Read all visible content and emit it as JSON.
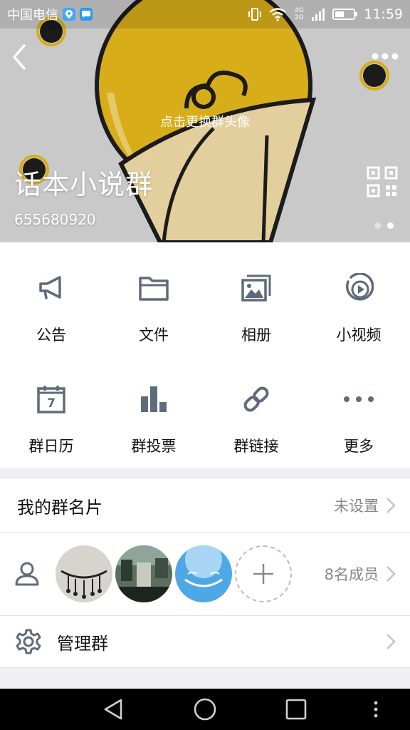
{
  "status_bar": {
    "carrier": "中国电信",
    "time": "11:59",
    "network": "4G 2G",
    "icons": [
      "location-notification-icon",
      "message-notification-icon",
      "vibrate-icon",
      "wifi-icon",
      "signal-icon",
      "battery-icon"
    ]
  },
  "header": {
    "avatar_hint": "点击更换群头像",
    "group_name": "话本小说群",
    "group_id": "655680920",
    "page_count": 2,
    "active_page": 2
  },
  "grid": {
    "items": [
      {
        "label": "公告",
        "icon": "megaphone-icon"
      },
      {
        "label": "文件",
        "icon": "folder-icon"
      },
      {
        "label": "相册",
        "icon": "album-icon"
      },
      {
        "label": "小视频",
        "icon": "video-icon"
      },
      {
        "label": "群日历",
        "icon": "calendar-icon",
        "badge": "7"
      },
      {
        "label": "群投票",
        "icon": "bar-chart-icon"
      },
      {
        "label": "群链接",
        "icon": "link-icon"
      },
      {
        "label": "更多",
        "icon": "more-dots-icon"
      }
    ]
  },
  "card": {
    "title": "我的群名片",
    "value": "未设置"
  },
  "members": {
    "count_label": "8名成员",
    "icon": "members-icon"
  },
  "manage": {
    "title": "管理群",
    "icon": "gear-icon"
  },
  "colors": {
    "accent_icon": "#5f6b7a",
    "balloon_yellow": "#d8ad1a",
    "balloon_cream": "#e3cf9d",
    "header_bg": "#c9c9c9"
  }
}
